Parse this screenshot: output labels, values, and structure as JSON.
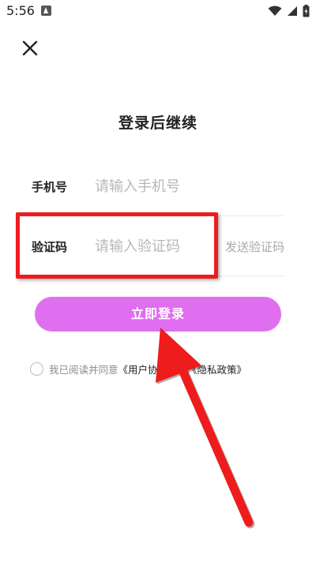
{
  "status_bar": {
    "time": "5:56"
  },
  "page": {
    "title": "登录后继续"
  },
  "form": {
    "phone": {
      "label": "手机号",
      "value": "",
      "placeholder": "请输入手机号"
    },
    "code": {
      "label": "验证码",
      "value": "",
      "placeholder": "请输入验证码",
      "send_label": "发送验证码"
    },
    "login_label": "立即登录"
  },
  "agreement": {
    "prefix": "我已阅读并同意",
    "user_agreement": "《用户协议》",
    "conjunction": "和",
    "privacy_policy": "《隐私政策》",
    "checked": false
  },
  "colors": {
    "accent": "#e06ff0",
    "highlight": "#ee1c1c"
  },
  "icons": [
    "notification-icon",
    "wifi-icon",
    "signal-icon",
    "battery-icon",
    "close-icon"
  ]
}
